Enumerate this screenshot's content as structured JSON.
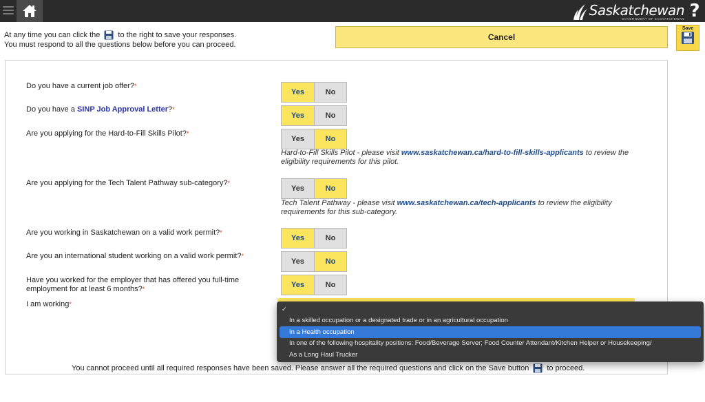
{
  "header": {
    "brand_name": "Saskatchewan",
    "brand_sub": "GOVERNMENT OF SASKATCHEWAN",
    "help_label": "?"
  },
  "intro": {
    "line1_before": "At any time you can click the",
    "line1_after": "to the right to save your responses.",
    "line2": "You must respond to all the questions below before you can proceed."
  },
  "toolbar": {
    "cancel_label": "Cancel",
    "save_label": "Save"
  },
  "options": {
    "yes": "Yes",
    "no": "No"
  },
  "required_mark": "*",
  "questions": [
    {
      "text": "Do you have a current job offer?",
      "answer": "Yes"
    },
    {
      "text_before": "Do you have a ",
      "link": "SINP Job Approval Letter",
      "text_after": "?",
      "answer": "Yes"
    },
    {
      "text": "Are you applying for the Hard-to-Fill Skills Pilot?",
      "answer": "No",
      "note": {
        "before": "Hard-to-Fill Skills Pilot - please visit ",
        "link": "www.saskatchewan.ca/hard-to-fill-skills-applicants",
        "after": " to review the eligibility requirements for this pilot."
      }
    },
    {
      "text": "Are you applying for the Tech Talent Pathway sub-category?",
      "answer": "No",
      "note": {
        "before": "Tech Talent Pathway - please visit ",
        "link": "www.saskatchewan.ca/tech-applicants",
        "after": " to review the eligibility requirements for this sub-category."
      }
    },
    {
      "text": "Are you working in Saskatchewan on a valid work permit?",
      "answer": "Yes"
    },
    {
      "text": "Are you an international student working on a valid work permit?",
      "answer": "No"
    },
    {
      "text": "Have you worked for the employer that has offered you full-time employment for at least 6 months?",
      "answer": "Yes"
    },
    {
      "text": "I am working"
    }
  ],
  "dropdown": {
    "check": "✓",
    "selected_index": 1,
    "options": [
      "",
      "In a skilled occupation or a designated trade or in an agricultural occupation",
      "In a Health occupation",
      "In one of the following hospitality positions: Food/Beverage Server; Food Counter Attendant/Kitchen Helper or Housekeeping/",
      "As a Long Haul Trucker"
    ]
  },
  "footer": {
    "before": "You cannot proceed until all required responses have been saved. Please answer all the required questions and click on the Save button",
    "after": "to proceed."
  },
  "colors": {
    "accent_yellow": "#fbe45e",
    "selected_text": "#1a4a8a",
    "link_blue": "#1d4b8c",
    "required_orange": "#d04a16",
    "dropdown_highlight": "#3478d8"
  }
}
